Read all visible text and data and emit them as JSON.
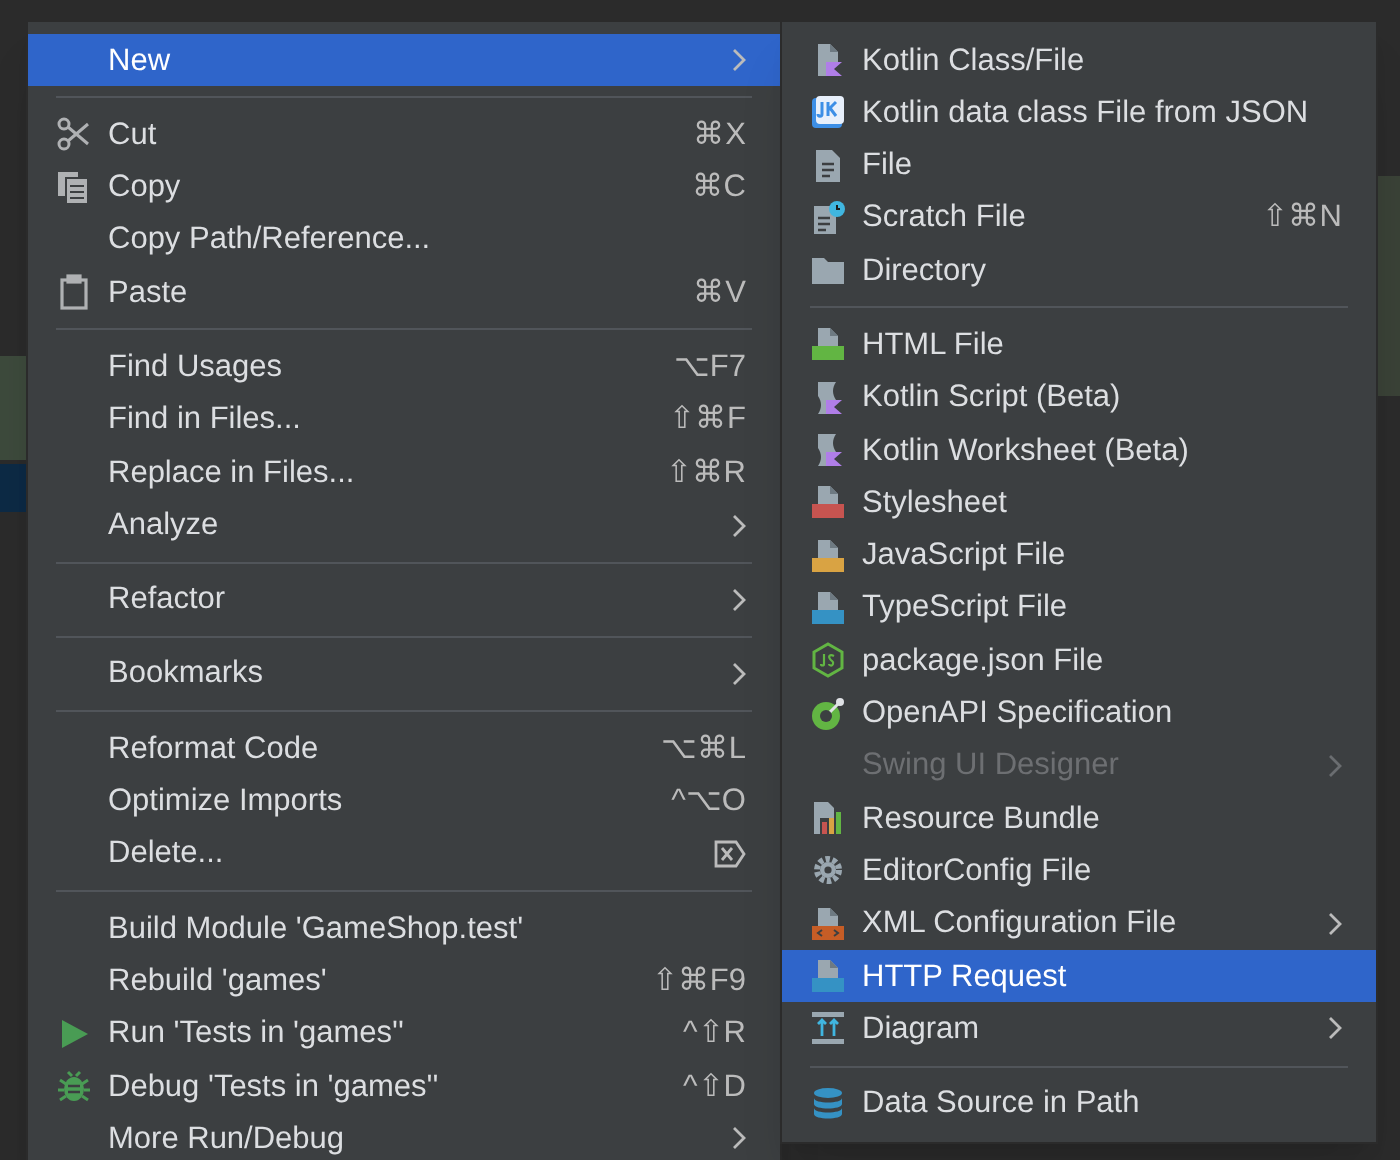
{
  "context_menu": {
    "sections": [
      [
        {
          "label": "New",
          "kind": "plain",
          "submenu": true,
          "selected": true
        }
      ],
      [
        {
          "label": "Cut",
          "kind": "scissors",
          "shortcut": "⌘X",
          "selected": false
        },
        {
          "label": "Copy",
          "kind": "copy",
          "shortcut": "⌘C",
          "selected": false
        },
        {
          "label": "Copy Path/Reference...",
          "kind": "plain",
          "selected": false
        },
        {
          "label": "Paste",
          "kind": "paste",
          "shortcut": "⌘V",
          "selected": false
        }
      ],
      [
        {
          "label": "Find Usages",
          "kind": "plain",
          "shortcut": "⌥F7",
          "selected": false
        },
        {
          "label": "Find in Files...",
          "kind": "plain",
          "shortcut": "⇧⌘F",
          "selected": false
        },
        {
          "label": "Replace in Files...",
          "kind": "plain",
          "shortcut": "⇧⌘R",
          "selected": false
        },
        {
          "label": "Analyze",
          "kind": "plain",
          "submenu": true,
          "selected": false
        }
      ],
      [
        {
          "label": "Refactor",
          "kind": "plain",
          "submenu": true,
          "selected": false
        }
      ],
      [
        {
          "label": "Bookmarks",
          "kind": "plain",
          "submenu": true,
          "selected": false
        }
      ],
      [
        {
          "label": "Reformat Code",
          "kind": "plain",
          "shortcut": "⌥⌘L",
          "selected": false
        },
        {
          "label": "Optimize Imports",
          "kind": "plain",
          "shortcut": "^⌥O",
          "selected": false
        },
        {
          "label": "Delete...",
          "kind": "delete",
          "selected": false
        }
      ],
      [
        {
          "label": "Build Module 'GameShop.test'",
          "kind": "plain",
          "selected": false
        },
        {
          "label": "Rebuild 'games'",
          "kind": "plain",
          "shortcut": "⇧⌘F9",
          "selected": false
        },
        {
          "label": "Run 'Tests in 'games''",
          "kind": "run",
          "shortcut": "^⇧R",
          "selected": false
        },
        {
          "label": "Debug 'Tests in 'games''",
          "kind": "debug",
          "shortcut": "^⇧D",
          "selected": false
        },
        {
          "label": "More Run/Debug",
          "kind": "plain",
          "submenu": true,
          "selected": false
        }
      ]
    ]
  },
  "new_submenu": {
    "sections": [
      [
        {
          "label": "Kotlin Class/File",
          "kind": "kotlin",
          "selected": false
        },
        {
          "label": "Kotlin data class File from JSON",
          "kind": "jk",
          "selected": false
        },
        {
          "label": "File",
          "kind": "file",
          "selected": false
        },
        {
          "label": "Scratch File",
          "kind": "scratch",
          "shortcut": "⇧⌘N",
          "selected": false
        },
        {
          "label": "Directory",
          "kind": "folder",
          "selected": false
        }
      ],
      [
        {
          "label": "HTML File",
          "kind": "html",
          "selected": false
        },
        {
          "label": "Kotlin Script (Beta)",
          "kind": "script",
          "selected": false
        },
        {
          "label": "Kotlin Worksheet (Beta)",
          "kind": "script",
          "selected": false
        },
        {
          "label": "Stylesheet",
          "kind": "css",
          "selected": false
        },
        {
          "label": "JavaScript File",
          "kind": "js",
          "selected": false
        },
        {
          "label": "TypeScript File",
          "kind": "ts",
          "selected": false
        },
        {
          "label": "package.json File",
          "kind": "node",
          "selected": false
        },
        {
          "label": "OpenAPI Specification",
          "kind": "openapi",
          "selected": false
        },
        {
          "label": "Swing UI Designer",
          "kind": "plain",
          "submenu": true,
          "disabled": true,
          "selected": false
        },
        {
          "label": "Resource Bundle",
          "kind": "bundle",
          "selected": false
        },
        {
          "label": "EditorConfig File",
          "kind": "gear",
          "selected": false
        },
        {
          "label": "XML Configuration File",
          "kind": "xml",
          "submenu": true,
          "selected": false
        },
        {
          "label": "HTTP Request",
          "kind": "api",
          "selected": true
        },
        {
          "label": "Diagram",
          "kind": "diagram",
          "submenu": true,
          "selected": false
        }
      ],
      [
        {
          "label": "Data Source in Path",
          "kind": "database",
          "selected": false
        }
      ]
    ]
  }
}
